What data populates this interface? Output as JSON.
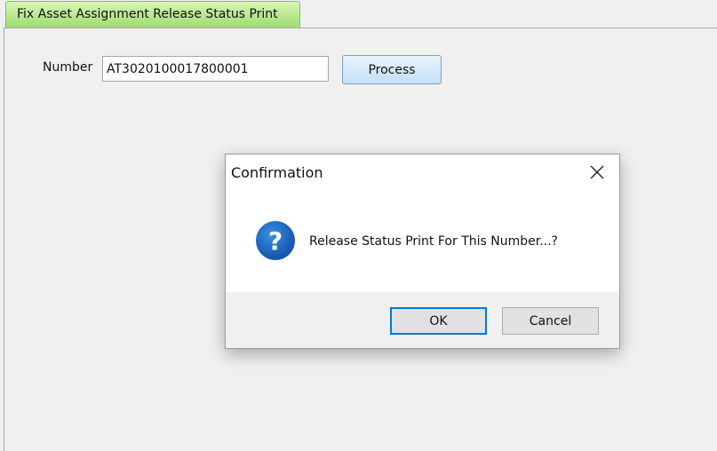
{
  "tab": {
    "title": "Fix Asset Assignment Release Status Print"
  },
  "form": {
    "number_label": "Number",
    "number_value": "AT3020100017800001",
    "process_label": "Process"
  },
  "dialog": {
    "title": "Confirmation",
    "message": "Release Status Print For This Number...?",
    "ok_label": "OK",
    "cancel_label": "Cancel",
    "icon": "question-icon"
  },
  "colors": {
    "tab_green": "#9fdc6e",
    "process_blue": "#c4def7",
    "question_blue": "#1565c0",
    "ok_focus": "#0078d7"
  }
}
